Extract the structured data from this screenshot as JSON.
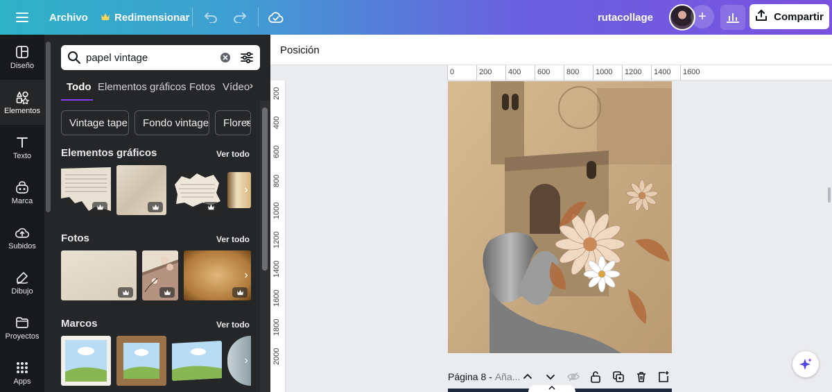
{
  "topbar": {
    "file_label": "Archivo",
    "resize_label": "Redimensionar",
    "project_name": "rutacollage",
    "share_label": "Compartir",
    "add_symbol": "+"
  },
  "rail": {
    "items": [
      {
        "label": "Diseño",
        "icon": "layout-icon"
      },
      {
        "label": "Elementos",
        "icon": "shapes-icon",
        "active": true
      },
      {
        "label": "Texto",
        "icon": "text-icon"
      },
      {
        "label": "Marca",
        "icon": "brand-icon"
      },
      {
        "label": "Subidos",
        "icon": "upload-cloud-icon"
      },
      {
        "label": "Dibujo",
        "icon": "draw-icon"
      },
      {
        "label": "Proyectos",
        "icon": "folder-icon"
      },
      {
        "label": "Apps",
        "icon": "apps-grid-icon"
      }
    ]
  },
  "panel": {
    "search_value": "papel vintage",
    "tabs": [
      "Todo",
      "Elementos gráficos",
      "Fotos",
      "Vídeos"
    ],
    "chips": [
      "Vintage tape",
      "Fondo vintage",
      "Flores"
    ],
    "sections": [
      {
        "title": "Elementos gráficos",
        "more": "Ver todo"
      },
      {
        "title": "Fotos",
        "more": "Ver todo"
      },
      {
        "title": "Marcos",
        "more": "Ver todo"
      }
    ]
  },
  "canvas": {
    "context_label": "Posición",
    "ruler_top": [
      "0",
      "200",
      "400",
      "600",
      "800",
      "1000",
      "1200",
      "1400",
      "1600"
    ],
    "ruler_left": [
      "200",
      "400",
      "600",
      "800",
      "1000",
      "1200",
      "1400",
      "1600",
      "1800",
      "2000"
    ],
    "page_label": "Página 8 -",
    "page_title_placeholder": "Aña..."
  },
  "colors": {
    "accent": "#8b3dff",
    "topbar_start": "#2fb2c7",
    "topbar_end": "#7a52e0",
    "panel_bg": "#252627",
    "rail_bg": "#18191b"
  }
}
